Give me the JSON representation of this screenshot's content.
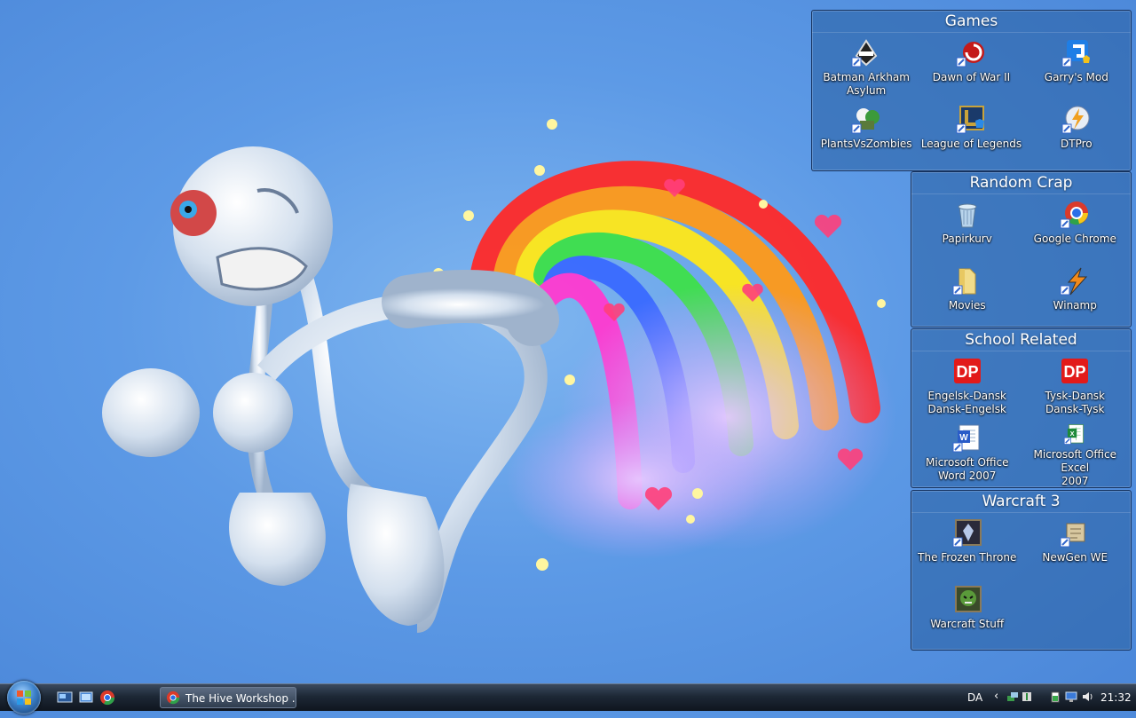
{
  "fences": [
    {
      "title": "Games",
      "icons": [
        {
          "label": "Batman Arkham\nAsylum",
          "icon": "batman-icon"
        },
        {
          "label": "Dawn of War II",
          "icon": "dawn-of-war-icon"
        },
        {
          "label": "Garry's Mod",
          "icon": "garrys-mod-icon"
        },
        {
          "label": "PlantsVsZombies",
          "icon": "plants-vs-zombies-icon"
        },
        {
          "label": "League of Legends",
          "icon": "league-of-legends-icon"
        },
        {
          "label": "DTPro",
          "icon": "dtpro-icon"
        }
      ]
    },
    {
      "title": "Random Crap",
      "icons": [
        {
          "label": "Papirkurv",
          "icon": "recycle-bin-icon"
        },
        {
          "label": "Google Chrome",
          "icon": "chrome-icon"
        },
        {
          "label": "Movies",
          "icon": "folder-icon"
        },
        {
          "label": "Winamp",
          "icon": "winamp-icon"
        }
      ]
    },
    {
      "title": "School Related",
      "icons": [
        {
          "label": "Engelsk-Dansk\nDansk-Engelsk",
          "icon": "dictionary-icon"
        },
        {
          "label": "Tysk-Dansk\nDansk-Tysk",
          "icon": "dictionary-icon"
        },
        {
          "label": "Microsoft Office\nWord 2007",
          "icon": "word-icon"
        },
        {
          "label": "Microsoft Office Excel\n2007",
          "icon": "excel-icon"
        }
      ]
    },
    {
      "title": "Warcraft 3",
      "icons": [
        {
          "label": "The Frozen Throne",
          "icon": "frozen-throne-icon"
        },
        {
          "label": "NewGen WE",
          "icon": "newgen-we-icon"
        },
        {
          "label": "Warcraft Stuff",
          "icon": "warcraft-stuff-icon"
        }
      ]
    }
  ],
  "taskbar": {
    "task_label": "The Hive Workshop ...",
    "language": "DA",
    "clock": "21:32"
  },
  "colors": {
    "desktop_blue": "#5d9ae6",
    "fence_bg": "#285fa0",
    "taskbar": "#1d2836"
  }
}
